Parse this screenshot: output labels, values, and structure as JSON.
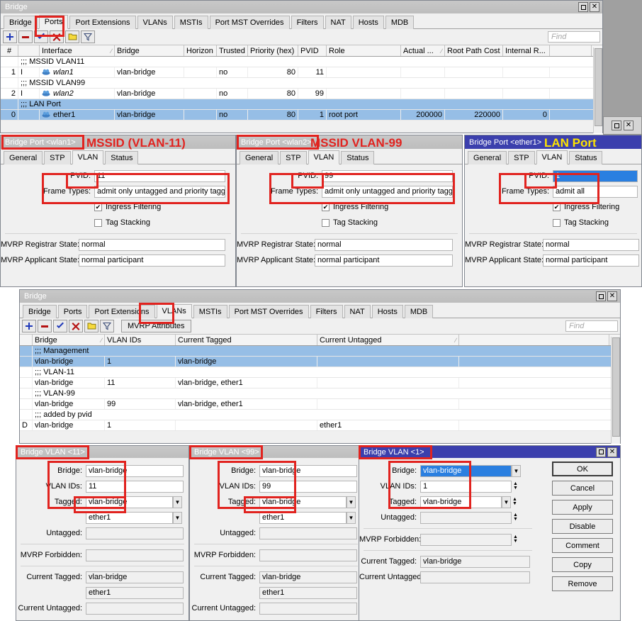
{
  "bridge_ports_window": {
    "title": "Bridge",
    "tabs": [
      {
        "label": "Bridge",
        "active": false
      },
      {
        "label": "Ports",
        "active": true
      },
      {
        "label": "Port Extensions",
        "active": false
      },
      {
        "label": "VLANs",
        "active": false
      },
      {
        "label": "MSTIs",
        "active": false
      },
      {
        "label": "Port MST Overrides",
        "active": false
      },
      {
        "label": "Filters",
        "active": false
      },
      {
        "label": "NAT",
        "active": false
      },
      {
        "label": "Hosts",
        "active": false
      },
      {
        "label": "MDB",
        "active": false
      }
    ],
    "toolbar": {
      "add": "add-icon",
      "remove": "remove-icon",
      "enable": "enable-check-icon",
      "disable": "disable-x-icon",
      "comment": "comment-icon",
      "filter": "filter-icon",
      "find_placeholder": "Find"
    },
    "columns": [
      "#",
      "",
      "Interface",
      "Bridge",
      "Horizon",
      "Trusted",
      "Priority (hex)",
      "PVID",
      "Role",
      "Actual ...",
      "Root Path Cost",
      "Internal R...",
      ""
    ],
    "rows": [
      {
        "kind": "comment",
        "text": ";;; MSSID VLAN11",
        "selected": false
      },
      {
        "kind": "data",
        "num": "1",
        "flags": "I",
        "interface": "wlan1",
        "bridge": "vlan-bridge",
        "horizon": "",
        "trusted": "no",
        "priority": "80",
        "pvid": "11",
        "role": "",
        "actual": "",
        "root_path_cost": "",
        "internal_r": "",
        "selected": false
      },
      {
        "kind": "comment",
        "text": ";;; MSSID VLAN99",
        "selected": false
      },
      {
        "kind": "data",
        "num": "2",
        "flags": "I",
        "interface": "wlan2",
        "bridge": "vlan-bridge",
        "horizon": "",
        "trusted": "no",
        "priority": "80",
        "pvid": "99",
        "role": "",
        "actual": "",
        "root_path_cost": "",
        "internal_r": "",
        "selected": false
      },
      {
        "kind": "comment",
        "text": ";;; LAN Port",
        "selected": true
      },
      {
        "kind": "data",
        "num": "0",
        "flags": "",
        "interface": "ether1",
        "bridge": "vlan-bridge",
        "horizon": "",
        "trusted": "no",
        "priority": "80",
        "pvid": "1",
        "role": "root port",
        "actual": "200000",
        "root_path_cost": "220000",
        "internal_r": "0",
        "selected": true
      }
    ]
  },
  "port_wlan1": {
    "title": "Bridge Port <wlan1>",
    "annotation": "MSSID (VLAN-11)",
    "tabs": [
      {
        "label": "General",
        "active": false
      },
      {
        "label": "STP",
        "active": false
      },
      {
        "label": "VLAN",
        "active": true
      },
      {
        "label": "Status",
        "active": false
      }
    ],
    "pvid_label": "PVID:",
    "pvid_value": "11",
    "frame_types_label": "Frame Types:",
    "frame_types_value": "admit only untagged and priority tagged",
    "ingress_filtering_label": "Ingress Filtering",
    "ingress_filtering_checked": true,
    "tag_stacking_label": "Tag Stacking",
    "tag_stacking_checked": false,
    "mvrp_registrar_label": "MVRP Registrar State:",
    "mvrp_registrar_value": "normal",
    "mvrp_applicant_label": "MVRP Applicant State:",
    "mvrp_applicant_value": "normal participant"
  },
  "port_wlan2": {
    "title": "Bridge Port <wlan2>",
    "annotation": "MSSID VLAN-99",
    "tabs": [
      {
        "label": "General",
        "active": false
      },
      {
        "label": "STP",
        "active": false
      },
      {
        "label": "VLAN",
        "active": true
      },
      {
        "label": "Status",
        "active": false
      }
    ],
    "pvid_label": "PVID:",
    "pvid_value": "99",
    "frame_types_label": "Frame Types:",
    "frame_types_value": "admit only untagged and priority tagged",
    "ingress_filtering_label": "Ingress Filtering",
    "ingress_filtering_checked": true,
    "tag_stacking_label": "Tag Stacking",
    "tag_stacking_checked": false,
    "mvrp_registrar_label": "MVRP Registrar State:",
    "mvrp_registrar_value": "normal",
    "mvrp_applicant_label": "MVRP Applicant State:",
    "mvrp_applicant_value": "normal participant"
  },
  "port_ether1": {
    "title": "Bridge Port <ether1>",
    "annotation": "LAN Port",
    "tabs": [
      {
        "label": "General",
        "active": false
      },
      {
        "label": "STP",
        "active": false
      },
      {
        "label": "VLAN",
        "active": true
      },
      {
        "label": "Status",
        "active": false
      }
    ],
    "pvid_label": "PVID:",
    "pvid_value": "1",
    "frame_types_label": "Frame Types:",
    "frame_types_value": "admit all",
    "ingress_filtering_label": "Ingress Filtering",
    "ingress_filtering_checked": true,
    "tag_stacking_label": "Tag Stacking",
    "tag_stacking_checked": false,
    "mvrp_registrar_label": "MVRP Registrar State:",
    "mvrp_registrar_value": "normal",
    "mvrp_applicant_label": "MVRP Applicant State:",
    "mvrp_applicant_value": "normal participant"
  },
  "bridge_vlans_window": {
    "title": "Bridge",
    "tabs": [
      {
        "label": "Bridge",
        "active": false
      },
      {
        "label": "Ports",
        "active": false
      },
      {
        "label": "Port Extensions",
        "active": false
      },
      {
        "label": "VLANs",
        "active": true
      },
      {
        "label": "MSTIs",
        "active": false
      },
      {
        "label": "Port MST Overrides",
        "active": false
      },
      {
        "label": "Filters",
        "active": false
      },
      {
        "label": "NAT",
        "active": false
      },
      {
        "label": "Hosts",
        "active": false
      },
      {
        "label": "MDB",
        "active": false
      }
    ],
    "toolbar": {
      "mvrp_attributes": "MVRP Attributes",
      "find_placeholder": "Find"
    },
    "columns": [
      "",
      "Bridge",
      "VLAN IDs",
      "Current Tagged",
      "Current Untagged",
      ""
    ],
    "rows": [
      {
        "kind": "comment",
        "text": ";;; Management",
        "selected": true
      },
      {
        "kind": "data",
        "flag": "",
        "bridge": "vlan-bridge",
        "vlan_ids": "1",
        "current_tagged": "vlan-bridge",
        "current_untagged": "",
        "selected": true
      },
      {
        "kind": "comment",
        "text": ";;; VLAN-11",
        "selected": false
      },
      {
        "kind": "data",
        "flag": "",
        "bridge": "vlan-bridge",
        "vlan_ids": "11",
        "current_tagged": "vlan-bridge, ether1",
        "current_untagged": "",
        "selected": false
      },
      {
        "kind": "comment",
        "text": ";;; VLAN-99",
        "selected": false
      },
      {
        "kind": "data",
        "flag": "",
        "bridge": "vlan-bridge",
        "vlan_ids": "99",
        "current_tagged": "vlan-bridge, ether1",
        "current_untagged": "",
        "selected": false
      },
      {
        "kind": "comment",
        "text": ";;; added by pvid",
        "selected": false
      },
      {
        "kind": "data",
        "flag": "D",
        "bridge": "vlan-bridge",
        "vlan_ids": "1",
        "current_tagged": "",
        "current_untagged": "ether1",
        "selected": false
      }
    ]
  },
  "vlan_11": {
    "title": "Bridge VLAN <11>",
    "bridge_label": "Bridge:",
    "bridge_value": "vlan-bridge",
    "vlan_ids_label": "VLAN IDs:",
    "vlan_ids_value": "11",
    "tagged_label": "Tagged:",
    "tagged_value_1": "vlan-bridge",
    "tagged_value_2": "ether1",
    "untagged_label": "Untagged:",
    "untagged_value": "",
    "mvrp_forbidden_label": "MVRP Forbidden:",
    "mvrp_forbidden_value": "",
    "current_tagged_label": "Current Tagged:",
    "current_tagged_value_1": "vlan-bridge",
    "current_tagged_value_2": "ether1",
    "current_untagged_label": "Current Untagged:",
    "current_untagged_value": ""
  },
  "vlan_99": {
    "title": "Bridge VLAN <99>",
    "bridge_label": "Bridge:",
    "bridge_value": "vlan-bridge",
    "vlan_ids_label": "VLAN IDs:",
    "vlan_ids_value": "99",
    "tagged_label": "Tagged:",
    "tagged_value_1": "vlan-bridge",
    "tagged_value_2": "ether1",
    "untagged_label": "Untagged:",
    "untagged_value": "",
    "mvrp_forbidden_label": "MVRP Forbidden:",
    "mvrp_forbidden_value": "",
    "current_tagged_label": "Current Tagged:",
    "current_tagged_value_1": "vlan-bridge",
    "current_tagged_value_2": "ether1",
    "current_untagged_label": "Current Untagged:",
    "current_untagged_value": ""
  },
  "vlan_1": {
    "title": "Bridge VLAN <1>",
    "bridge_label": "Bridge:",
    "bridge_value": "vlan-bridge",
    "vlan_ids_label": "VLAN IDs:",
    "vlan_ids_value": "1",
    "tagged_label": "Tagged:",
    "tagged_value_1": "vlan-bridge",
    "untagged_label": "Untagged:",
    "untagged_value": "",
    "mvrp_forbidden_label": "MVRP Forbidden:",
    "mvrp_forbidden_value": "",
    "current_tagged_label": "Current Tagged:",
    "current_tagged_value": "vlan-bridge",
    "current_untagged_label": "Current Untagged:",
    "current_untagged_value": "",
    "buttons": [
      {
        "label": "OK",
        "default": true
      },
      {
        "label": "Cancel",
        "default": false
      },
      {
        "label": "Apply",
        "default": false
      },
      {
        "label": "Disable",
        "default": false
      },
      {
        "label": "Comment",
        "default": false
      },
      {
        "label": "Copy",
        "default": false
      },
      {
        "label": "Remove",
        "default": false
      }
    ]
  },
  "colors": {
    "annotation_red": "#e1231f",
    "annotation_yellow": "#ffe400",
    "selection_blue": "#96bee6",
    "titlebar_blue": "#3b3fad",
    "field_highlight": "#2a7fe0"
  }
}
